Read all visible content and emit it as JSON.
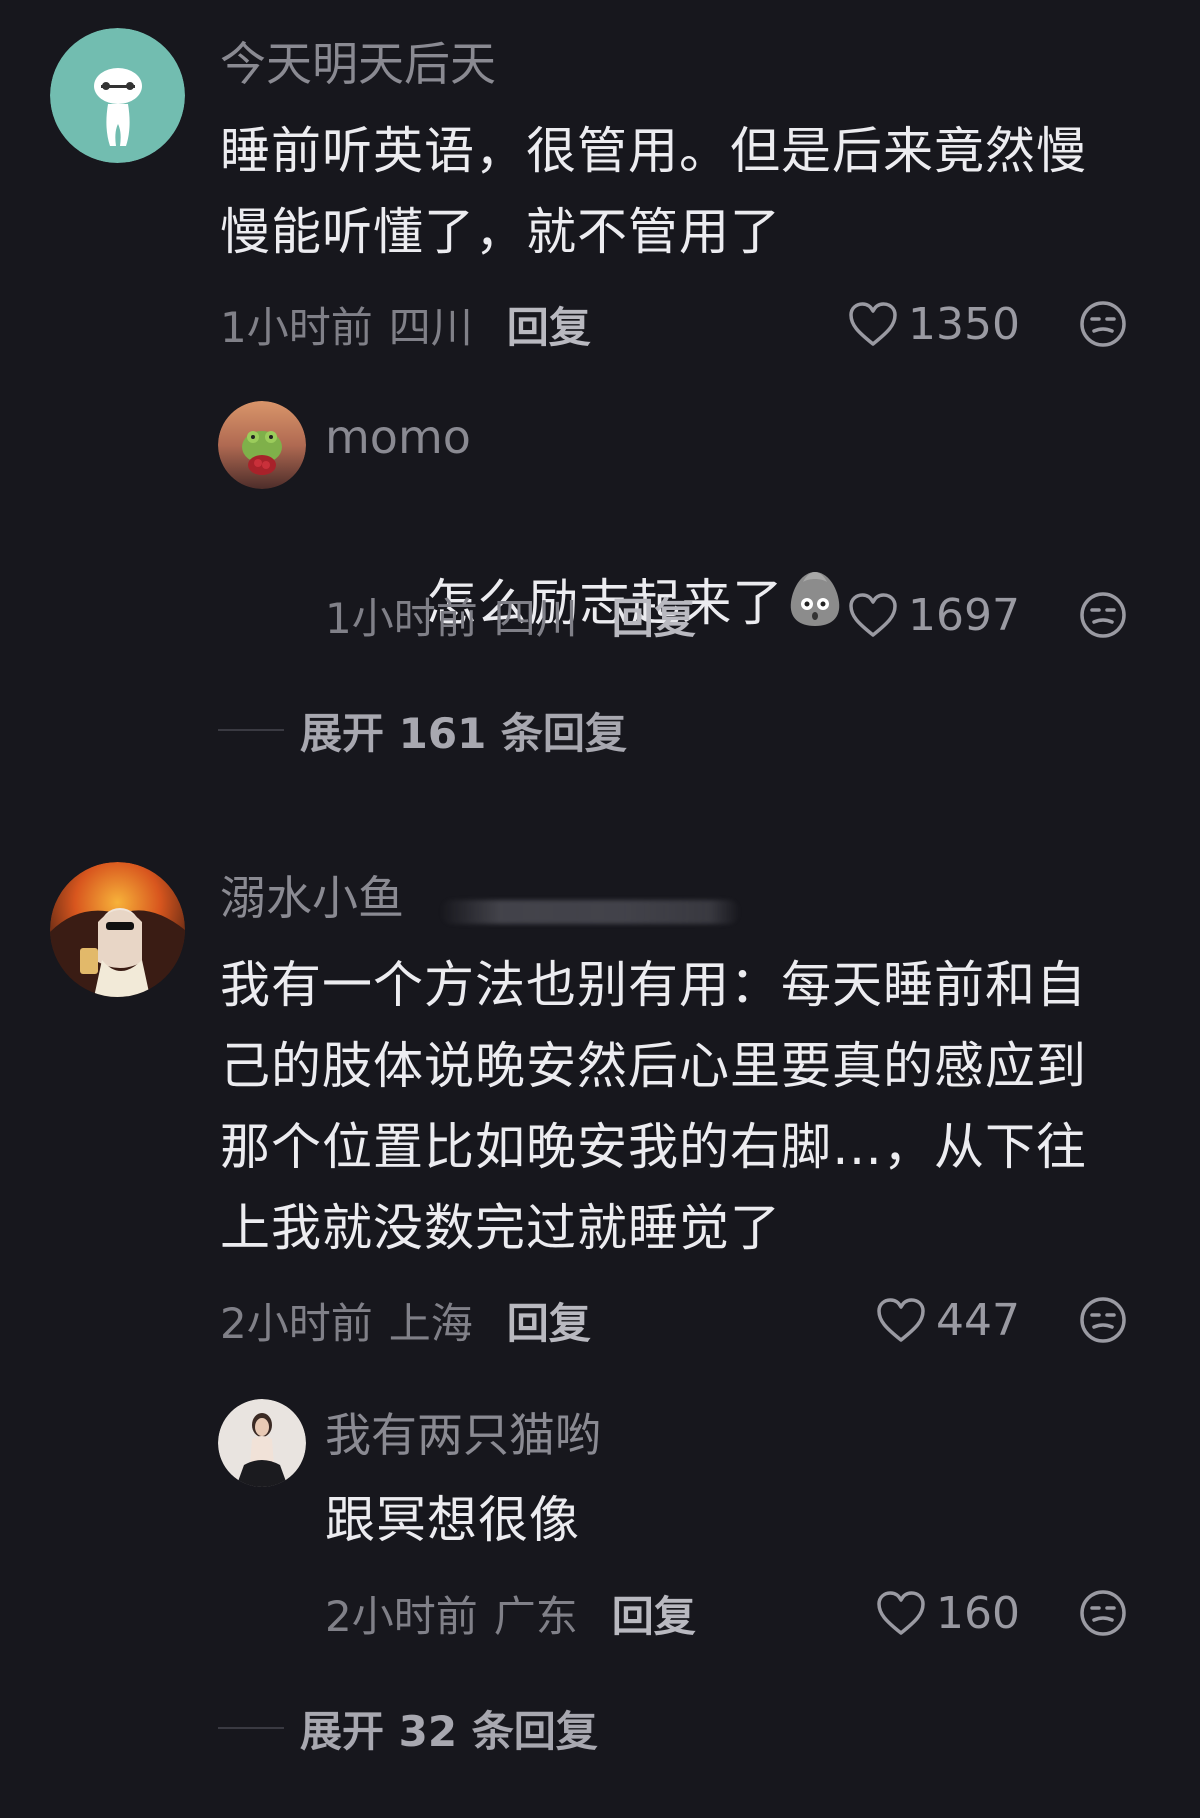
{
  "comments": [
    {
      "username": "今天明天后天",
      "content": "睡前听英语，很管用。但是后来竟然慢\n慢能听懂了，就不管用了",
      "time": "1小时前",
      "location": "四川",
      "reply_label": "回复",
      "likes": "1350",
      "avatar_icon": "baymax-avatar-icon",
      "replies": [
        {
          "username": "momo",
          "content": "怎么励志起来了",
          "emoji_icon": "shocked-potato-emoji-icon",
          "time": "1小时前",
          "location": "四川",
          "reply_label": "回复",
          "likes": "1697"
        }
      ],
      "expand_label": "展开 161 条回复"
    },
    {
      "username": "溺水小鱼",
      "content": "我有一个方法也别有用：每天睡前和自\n己的肢体说晚安然后心里要真的感应到\n那个位置比如晚安我的右脚…，从下往\n上我就没数完过就睡觉了",
      "time": "2小时前",
      "location": "上海",
      "reply_label": "回复",
      "likes": "447",
      "replies": [
        {
          "username": "我有两只猫哟",
          "content": "跟冥想很像",
          "time": "2小时前",
          "location": "广东",
          "reply_label": "回复",
          "likes": "160"
        }
      ],
      "expand_label": "展开 32 条回复"
    }
  ],
  "colors": {
    "background": "#17171d",
    "username": "#8a8a92",
    "content": "#ececf0",
    "meta": "#808088"
  }
}
